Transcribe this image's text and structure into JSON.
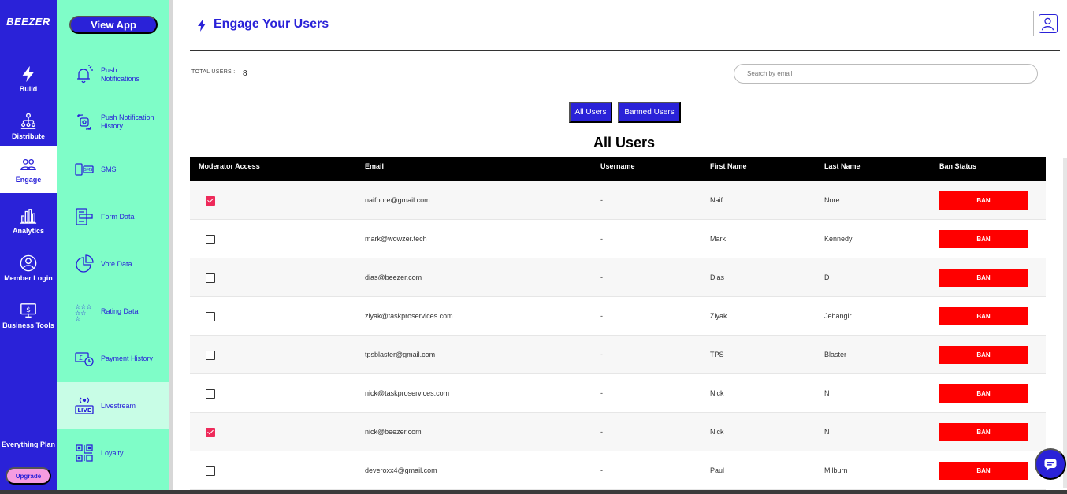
{
  "app": {
    "logo": "BEEZER",
    "plan_label": "Everything Plan",
    "upgrade_label": "Upgrade"
  },
  "rail": [
    {
      "label": "Build",
      "icon": "bolt-icon"
    },
    {
      "label": "Distribute",
      "icon": "hierarchy-icon"
    },
    {
      "label": "Engage",
      "icon": "users-icon",
      "active": true
    },
    {
      "label": "Analytics",
      "icon": "bar-chart-icon"
    },
    {
      "label": "Member Login",
      "icon": "user-circle-icon"
    },
    {
      "label": "Business Tools",
      "icon": "dollar-screen-icon"
    }
  ],
  "submenu": {
    "view_app": "View App",
    "items": [
      {
        "label": "Push Notifications",
        "icon": "bell-icon"
      },
      {
        "label": "Push Notification History",
        "icon": "history-icon"
      },
      {
        "label": "SMS",
        "icon": "sms-icon"
      },
      {
        "label": "Form Data",
        "icon": "form-icon"
      },
      {
        "label": "Vote Data",
        "icon": "pie-chart-icon"
      },
      {
        "label": "Rating Data",
        "icon": "stars-icon"
      },
      {
        "label": "Payment History",
        "icon": "payment-clock-icon"
      },
      {
        "label": "Livestream",
        "icon": "live-icon",
        "active": true
      },
      {
        "label": "Loyalty",
        "icon": "qr-code-icon"
      }
    ]
  },
  "header": {
    "title": "Engage Your Users"
  },
  "stats": {
    "total_label": "TOTAL USERS :",
    "total_value": "8"
  },
  "search": {
    "placeholder": "Search by email",
    "value": ""
  },
  "tabs": [
    {
      "label": "All Users",
      "active": true
    },
    {
      "label": "Banned Users",
      "active": false
    }
  ],
  "section_title": "All Users",
  "table": {
    "columns": [
      "Moderator Access",
      "Email",
      "Username",
      "First Name",
      "Last Name",
      "Ban Status"
    ],
    "ban_label": "BAN",
    "rows": [
      {
        "moderator": true,
        "email": "naifnore@gmail.com",
        "username": "-",
        "first": "Naif",
        "last": "Nore"
      },
      {
        "moderator": false,
        "email": "mark@wowzer.tech",
        "username": "-",
        "first": "Mark",
        "last": "Kennedy"
      },
      {
        "moderator": false,
        "email": "dias@beezer.com",
        "username": "-",
        "first": "Dias",
        "last": "D"
      },
      {
        "moderator": false,
        "email": "ziyak@taskproservices.com",
        "username": "-",
        "first": "Ziyak",
        "last": "Jehangir"
      },
      {
        "moderator": false,
        "email": "tpsblaster@gmail.com",
        "username": "-",
        "first": "TPS",
        "last": "Blaster"
      },
      {
        "moderator": false,
        "email": "nick@taskproservices.com",
        "username": "-",
        "first": "Nick",
        "last": "N"
      },
      {
        "moderator": true,
        "email": "nick@beezer.com",
        "username": "-",
        "first": "Nick",
        "last": "N"
      },
      {
        "moderator": false,
        "email": "deveroxx4@gmail.com",
        "username": "-",
        "first": "Paul",
        "last": "Milburn"
      }
    ]
  },
  "colors": {
    "brand": "#2a22d8",
    "submenu_bg": "#7ffdc8",
    "ban": "#ff0000",
    "checked": "#ee2a5a"
  }
}
